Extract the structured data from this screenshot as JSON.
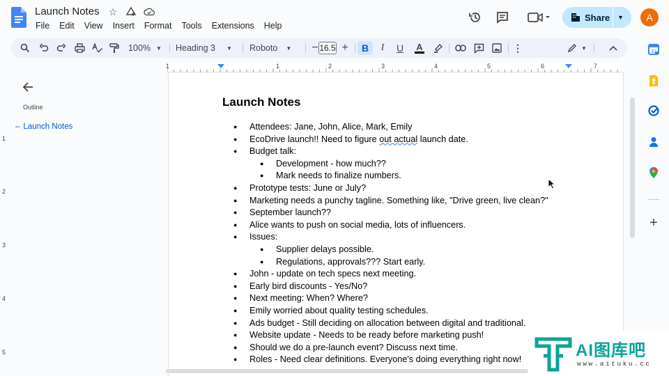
{
  "app": {
    "doc_title": "Launch Notes",
    "menu": [
      "File",
      "Edit",
      "View",
      "Insert",
      "Format",
      "Tools",
      "Extensions",
      "Help"
    ],
    "share_label": "Share",
    "avatar_initial": "A"
  },
  "toolbar": {
    "zoom": "100%",
    "style": "Heading 3",
    "font": "Roboto",
    "font_size": "16.5",
    "minus": "−",
    "plus": "+",
    "bold": "B",
    "italic": "I",
    "underline": "U",
    "text_color_letter": "A"
  },
  "ruler": {
    "marks": [
      "1",
      "1",
      "2",
      "3",
      "4",
      "5",
      "6",
      "7"
    ],
    "vertical_marks": [
      "1",
      "2",
      "3",
      "4",
      "5"
    ]
  },
  "outline": {
    "label": "Outline",
    "items": [
      "Launch Notes"
    ]
  },
  "document": {
    "heading": "Launch Notes",
    "bullets": [
      {
        "level": 1,
        "text": "Attendees: Jane, John, Alice, Mark, Emily"
      },
      {
        "level": 1,
        "text": "EcoDrive launch!! Need to figure out actual launch date."
      },
      {
        "level": 1,
        "text": "Budget talk:"
      },
      {
        "level": 2,
        "text": "Development - how much??"
      },
      {
        "level": 2,
        "text": "Mark needs to finalize numbers."
      },
      {
        "level": 1,
        "text": "Prototype tests: June or July?"
      },
      {
        "level": 1,
        "text": "Marketing needs a punchy tagline. Something like, \"Drive green, live clean?\""
      },
      {
        "level": 1,
        "text": "September launch??"
      },
      {
        "level": 1,
        "text": "Alice wants to push on social media, lots of influencers."
      },
      {
        "level": 1,
        "text": "Issues:"
      },
      {
        "level": 2,
        "text": "Supplier delays possible."
      },
      {
        "level": 2,
        "text": "Regulations, approvals??? Start early."
      },
      {
        "level": 1,
        "text": "John - update on tech specs next meeting."
      },
      {
        "level": 1,
        "text": "Early bird discounts - Yes/No?"
      },
      {
        "level": 1,
        "text": "Next meeting: When? Where?"
      },
      {
        "level": 1,
        "text": "Emily worried about quality testing schedules."
      },
      {
        "level": 1,
        "text": "Ads budget - Still deciding on allocation between digital and traditional."
      },
      {
        "level": 1,
        "text": "Website update - Needs to be ready before marketing push!"
      },
      {
        "level": 1,
        "text": "Should we do a pre-launch event? Discuss next time."
      },
      {
        "level": 1,
        "text": "Roles - Need clear definitions. Everyone's doing everything right now!"
      }
    ]
  },
  "watermark": {
    "text": "AI图库吧",
    "url": "www.aituku.cc"
  },
  "colors": {
    "accent": "#0b57d0",
    "share_bg": "#c2e7ff",
    "avatar": "#ef6c00",
    "watermark": "#0aa39a"
  }
}
